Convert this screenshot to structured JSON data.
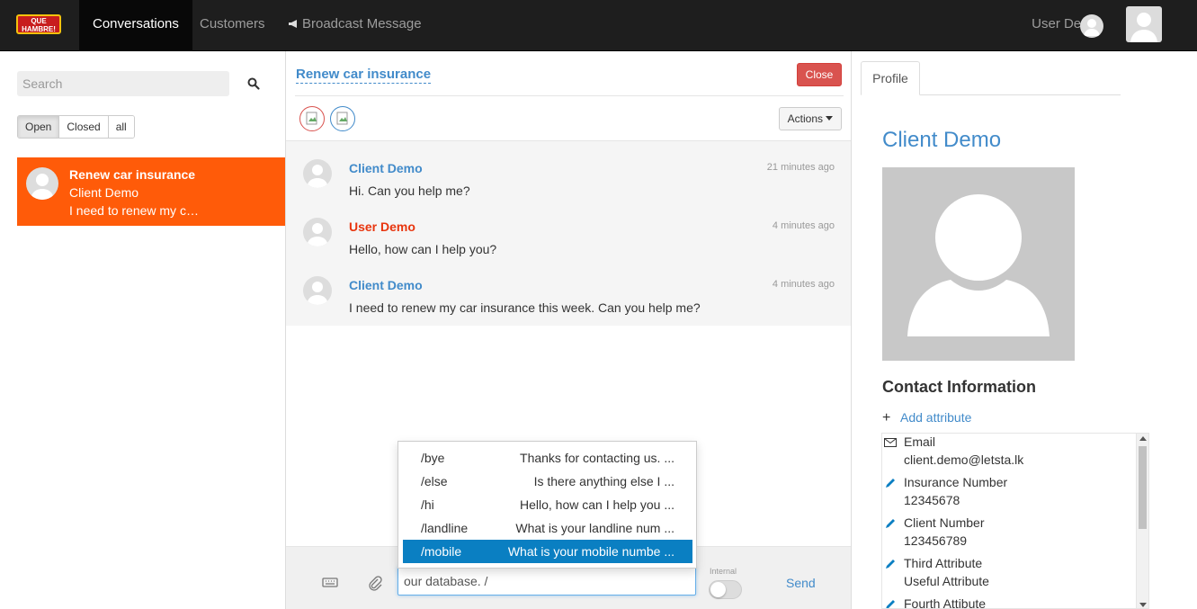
{
  "nav": {
    "logo_text": "QUE HAMBRE!",
    "items": [
      {
        "label": "Conversations",
        "active": true
      },
      {
        "label": "Customers",
        "active": false
      },
      {
        "label": "Broadcast Message",
        "active": false,
        "icon": "megaphone-icon"
      }
    ],
    "user_name": "User Demo"
  },
  "sidebar": {
    "search_placeholder": "Search",
    "filters": [
      "Open",
      "Closed",
      "all"
    ],
    "active_filter": "Open",
    "conversations": [
      {
        "title": "Renew car insurance",
        "client": "Client Demo",
        "preview": "I need to renew my c…"
      }
    ]
  },
  "conversation": {
    "title": "Renew car insurance",
    "close_label": "Close",
    "actions_label": "Actions",
    "messages": [
      {
        "author": "Client Demo",
        "text": "Hi. Can you help me?",
        "time": "21 minutes ago",
        "author_color": "#428bca"
      },
      {
        "author": "User Demo",
        "text": "Hello, how can I help you?",
        "time": "4 minutes ago",
        "author_color": "#e8350e"
      },
      {
        "author": "Client Demo",
        "text": "I need to renew my car insurance this week. Can you help me?",
        "time": "4 minutes ago",
        "author_color": "#428bca"
      }
    ],
    "canned_responses": [
      {
        "cmd": "/bye",
        "text": "Thanks for contacting us. ..."
      },
      {
        "cmd": "/else",
        "text": "Is there anything else I ..."
      },
      {
        "cmd": "/hi",
        "text": "Hello, how can I help you ..."
      },
      {
        "cmd": "/landline",
        "text": "What is your landline num ..."
      },
      {
        "cmd": "/mobile",
        "text": "What is your mobile numbe ...",
        "selected": true
      }
    ],
    "composer": {
      "value": "our database. /",
      "internal_label": "Internal",
      "send_label": "Send"
    }
  },
  "profile": {
    "tab_label": "Profile",
    "name": "Client Demo",
    "contact_title": "Contact Information",
    "add_attribute_label": "Add attribute",
    "attributes": [
      {
        "label": "Email",
        "value": "client.demo@letsta.lk",
        "icon": "envelope-icon"
      },
      {
        "label": "Insurance Number",
        "value": "12345678",
        "icon": "pencil-icon"
      },
      {
        "label": "Client Number",
        "value": "123456789",
        "icon": "pencil-icon"
      },
      {
        "label": "Third Attribute",
        "value": "Useful Attribute",
        "icon": "pencil-icon"
      },
      {
        "label": "Fourth Attibute",
        "value": "",
        "icon": "pencil-icon"
      }
    ]
  },
  "colors": {
    "accent": "#428bca",
    "conversation_highlight": "#ff5b09",
    "danger": "#d9534f",
    "canned_selected": "#0a7fc2"
  }
}
